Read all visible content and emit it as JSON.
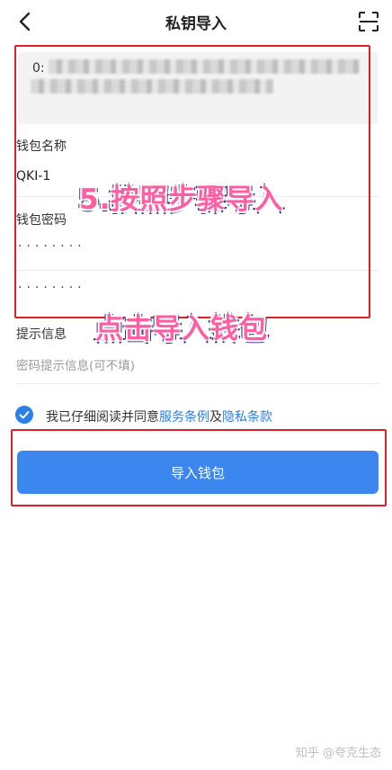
{
  "header": {
    "title": "私钥导入",
    "back_icon": "chevron-left-icon",
    "scan_icon": "scan-icon"
  },
  "key_input": {
    "prefix": "0:"
  },
  "wallet_name": {
    "label": "钱包名称",
    "value": "QKI-1"
  },
  "wallet_password": {
    "label": "钱包密码",
    "value": "········",
    "confirm_value": "········"
  },
  "hint": {
    "label": "提示信息",
    "placeholder": "密码提示信息(可不填)"
  },
  "agreement": {
    "checked": true,
    "prefix": "我已仔细阅读并同意",
    "terms_link": "服务条例",
    "conjunction": "及",
    "privacy_link": "隐私条款"
  },
  "import_button": {
    "label": "导入钱包"
  },
  "annotations": {
    "step": "5.按照步骤导入",
    "tap_import": "点击导入钱包",
    "frame_color": "#d9222a"
  },
  "watermark": "知乎 @夸克生态",
  "colors": {
    "accent": "#3b87ef",
    "link": "#2a7fe8",
    "annotation_text": "#ff5fa2"
  }
}
